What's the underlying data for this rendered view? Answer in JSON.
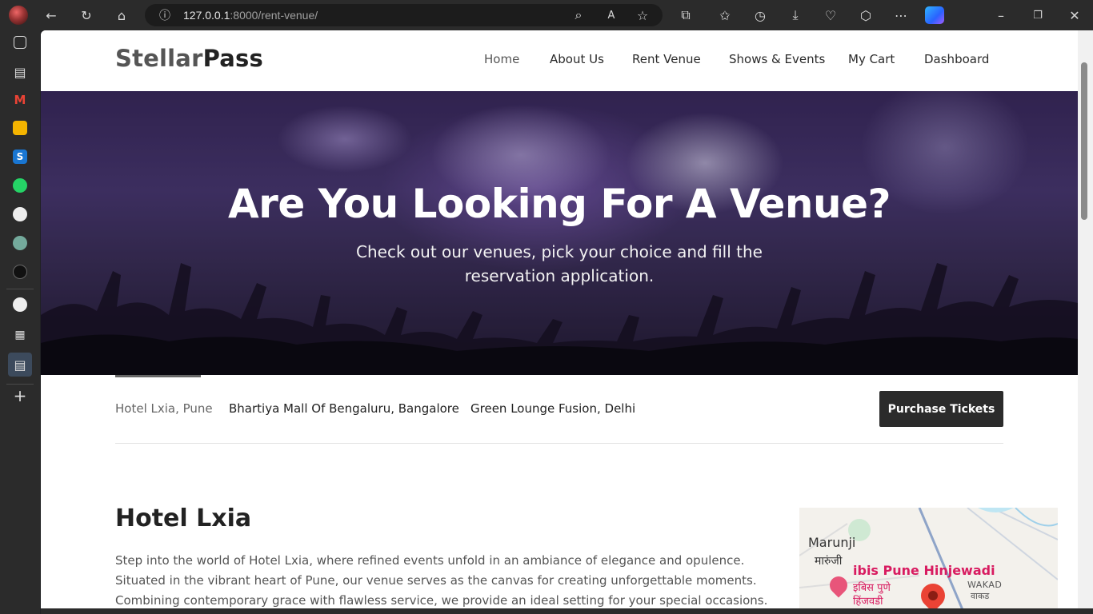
{
  "browser": {
    "url_host": "127.0.0.1",
    "url_path": ":8000/rent-venue/",
    "icons": [
      "back-icon",
      "refresh-icon",
      "home-icon",
      "info-icon",
      "zoom-icon",
      "read-aloud-icon",
      "star-icon",
      "extensions-icon",
      "favorites-icon",
      "history-icon",
      "download-icon",
      "performance-icon",
      "browser-essentials-icon",
      "more-icon",
      "copilot-icon",
      "minimize-icon",
      "restore-icon",
      "close-icon"
    ]
  },
  "sidebar": {
    "items": [
      "tabs-icon",
      "document-icon",
      "gmail-icon",
      "photos-icon",
      "s-app-icon",
      "whatsapp-icon",
      "github-icon",
      "chatgpt-icon",
      "app-icon",
      "github-icon",
      "calendar-icon",
      "document-icon",
      "add-icon"
    ]
  },
  "site": {
    "logo_part1": "Stellar",
    "logo_part2": "Pass",
    "nav": [
      "Home",
      "About Us",
      "Rent Venue",
      "Shows & Events",
      "My Cart",
      "Dashboard"
    ]
  },
  "hero": {
    "title": "Are You Looking For A Venue?",
    "subtitle": "Check out our venues, pick your choice and fill the reservation application."
  },
  "tabs": {
    "items": [
      "Hotel Lxia, Pune",
      "Bhartiya Mall Of Bengaluru, Bangalore",
      "Green Lounge Fusion, Delhi"
    ],
    "purchase_label": "Purchase Tickets"
  },
  "venue": {
    "title": "Hotel Lxia",
    "description": "Step into the world of Hotel Lxia, where refined events unfold in an ambiance of elegance and opulence. Situated in the vibrant heart of Pune, our venue serves as the canvas for creating unforgettable moments. Combining contemporary grace with flawless service, we provide an ideal setting for your special occasions. Hotel Lxia presents a diverse"
  },
  "map": {
    "place1": "Marunji",
    "place1_local": "मारुंजी",
    "poi": "ibis Pune Hinjewadi",
    "poi_local1": "इबिस पुणे",
    "poi_local2": "हिंजवडी",
    "place2": "WAKAD",
    "place2_local": "वाकड"
  },
  "colors": {
    "primary_dark": "#2b2b2b",
    "accent_pin": "#ea4335",
    "poi_text": "#d81b60"
  }
}
